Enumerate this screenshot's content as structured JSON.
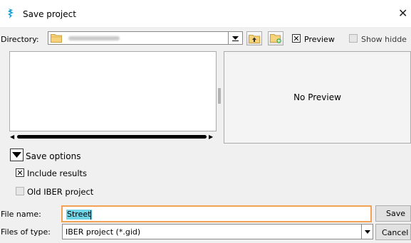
{
  "window": {
    "title": "Save project",
    "close_glyph": "✕",
    "icon": "iber-logo-icon",
    "accent": "#1a9fd6"
  },
  "toolbar": {
    "directory_label": "Directory:",
    "preview_label": "Preview",
    "preview_checked": true,
    "show_hidden_label": "Show hidde",
    "show_hidden_checked": false,
    "icons": [
      "folder-icon",
      "folder-up-icon",
      "new-folder-icon",
      "dropdown-arrow-icon"
    ]
  },
  "preview": {
    "text": "No Preview"
  },
  "options": {
    "toggle_label": "Save options",
    "include_results_label": "Include results",
    "include_results_checked": true,
    "old_iber_label": "Old IBER project",
    "old_iber_checked": false
  },
  "file": {
    "name_label": "File name:",
    "name_value": "Street",
    "type_label": "Files of type:",
    "type_value": "IBER project (*.gid)",
    "input_focus_color": "#f2a155",
    "selection_color": "#6fd4e6"
  },
  "buttons": {
    "save": "Save",
    "cancel": "Cancel"
  },
  "checkmark_glyph": "✕"
}
